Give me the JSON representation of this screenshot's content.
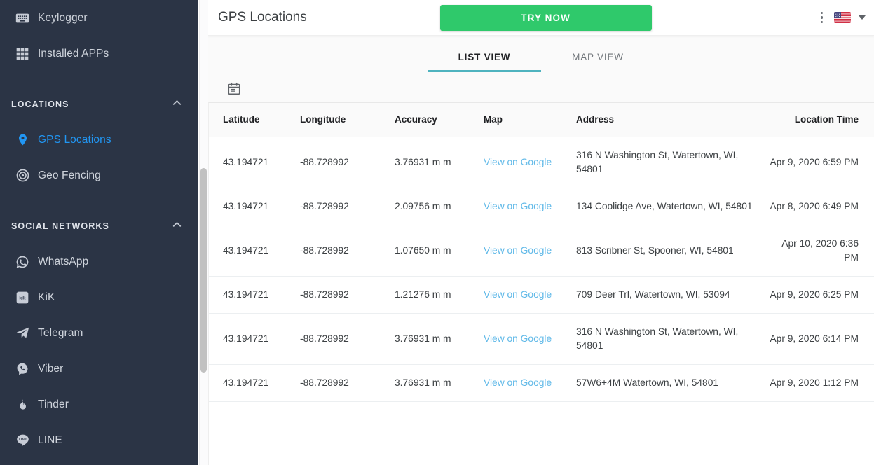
{
  "sidebar": {
    "items_top": [
      {
        "label": "Keylogger",
        "icon": "keyboard-icon",
        "active": false
      },
      {
        "label": "Installed APPs",
        "icon": "grid-apps-icon",
        "active": false
      }
    ],
    "sections": [
      {
        "title": "LOCATIONS",
        "chevron": "chevron-up-icon",
        "items": [
          {
            "label": "GPS Locations",
            "icon": "map-pin-icon",
            "active": true
          },
          {
            "label": "Geo Fencing",
            "icon": "target-icon",
            "active": false
          }
        ]
      },
      {
        "title": "SOCIAL NETWORKS",
        "chevron": "chevron-up-icon",
        "items": [
          {
            "label": "WhatsApp",
            "icon": "whatsapp-icon",
            "active": false
          },
          {
            "label": "KiK",
            "icon": "kik-icon",
            "active": false
          },
          {
            "label": "Telegram",
            "icon": "telegram-icon",
            "active": false
          },
          {
            "label": "Viber",
            "icon": "viber-icon",
            "active": false
          },
          {
            "label": "Tinder",
            "icon": "tinder-flame-icon",
            "active": false
          },
          {
            "label": "LINE",
            "icon": "line-icon",
            "active": false
          }
        ]
      }
    ]
  },
  "header": {
    "title": "GPS Locations",
    "try_now_label": "TRY NOW",
    "kebab_icon": "more-vertical-icon",
    "flag_icon": "us-flag-icon",
    "caret_icon": "chevron-down-icon"
  },
  "tabs": [
    {
      "label": "LIST VIEW",
      "active": true
    },
    {
      "label": "MAP VIEW",
      "active": false
    }
  ],
  "toolbar": {
    "calendar_icon": "calendar-icon"
  },
  "table": {
    "columns": [
      "Latitude",
      "Longitude",
      "Accuracy",
      "Map",
      "Address",
      "Location Time"
    ],
    "rows": [
      {
        "latitude": "43.194721",
        "longitude": "-88.728992",
        "accuracy": "3.76931 m m",
        "map": "View on Google",
        "address": "316 N Washington St, Watertown, WI, 54801",
        "time": "Apr 9, 2020 6:59 PM"
      },
      {
        "latitude": "43.194721",
        "longitude": "-88.728992",
        "accuracy": "2.09756 m m",
        "map": "View on Google",
        "address": "134 Coolidge Ave, Watertown, WI, 54801",
        "time": "Apr 8, 2020 6:49 PM"
      },
      {
        "latitude": "43.194721",
        "longitude": "-88.728992",
        "accuracy": "1.07650 m m",
        "map": "View on Google",
        "address": "813 Scribner St, Spooner, WI, 54801",
        "time": "Apr 10, 2020 6:36 PM"
      },
      {
        "latitude": "43.194721",
        "longitude": "-88.728992",
        "accuracy": "1.21276 m m",
        "map": "View on Google",
        "address": "709 Deer Trl, Watertown, WI, 53094",
        "time": "Apr 9, 2020 6:25 PM"
      },
      {
        "latitude": "43.194721",
        "longitude": "-88.728992",
        "accuracy": "3.76931 m m",
        "map": "View on Google",
        "address": "316 N Washington St, Watertown, WI, 54801",
        "time": "Apr 9, 2020 6:14 PM"
      },
      {
        "latitude": "43.194721",
        "longitude": "-88.728992",
        "accuracy": "3.76931 m m",
        "map": "View on Google",
        "address": "57W6+4M Watertown, WI, 54801",
        "time": "Apr 9, 2020 1:12 PM"
      }
    ]
  },
  "colors": {
    "sidebar_bg": "#2b3445",
    "accent_active": "#2196f3",
    "cta_green": "#2fc96b",
    "tab_underline": "#4fb3bf",
    "link_blue": "#60b9e8"
  }
}
